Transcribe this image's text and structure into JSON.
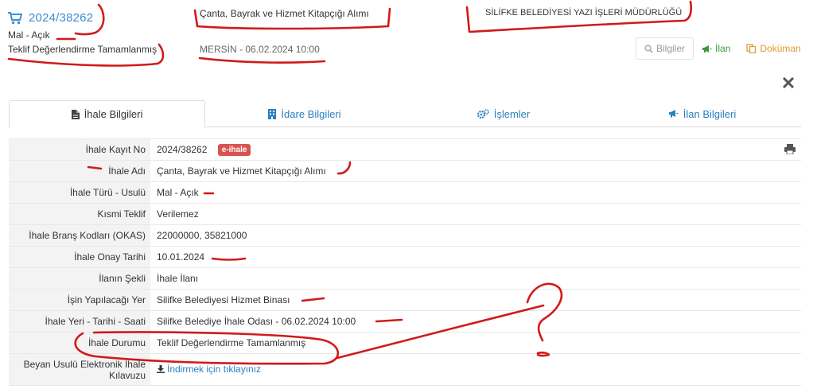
{
  "header": {
    "tender_no": "2024/38262",
    "type_line": "Mal - Açık",
    "status_line": "Teklif Değerlendirme Tamamlanmış",
    "title": "Çanta, Bayrak ve Hizmet Kitapçığı Alımı",
    "location_date": "MERSİN - 06.02.2024 10:00",
    "institution": "SİLİFKE BELEDİYESİ YAZI İŞLERİ MÜDÜRLÜĞÜ",
    "buttons": {
      "bilgiler": "Bilgiler",
      "ilan": "İlan",
      "dokuman": "Doküman"
    }
  },
  "tabs": [
    {
      "label": "İhale Bilgileri",
      "icon": "document-icon",
      "active": true
    },
    {
      "label": "İdare Bilgileri",
      "icon": "building-icon",
      "active": false
    },
    {
      "label": "İşlemler",
      "icon": "gears-icon",
      "active": false
    },
    {
      "label": "İlan Bilgileri",
      "icon": "megaphone-icon",
      "active": false
    }
  ],
  "details": {
    "kayit_no": {
      "label": "İhale Kayıt No",
      "value": "2024/38262",
      "badge": "e-ihale"
    },
    "ihale_adi": {
      "label": "İhale Adı",
      "value": "Çanta, Bayrak ve Hizmet Kitapçığı Alımı"
    },
    "turu_usulu": {
      "label": "İhale Türü - Usulü",
      "value": "Mal - Açık"
    },
    "kismi_teklif": {
      "label": "Kısmi Teklif",
      "value": "Verilemez"
    },
    "okas": {
      "label": "İhale Branş Kodları (OKAS)",
      "value": "22000000, 35821000"
    },
    "onay_tarihi": {
      "label": "İhale Onay Tarihi",
      "value": "10.01.2024"
    },
    "ilan_sekli": {
      "label": "İlanın Şekli",
      "value": "İhale İlanı"
    },
    "yapilacagi_yer": {
      "label": "İşin Yapılacağı Yer",
      "value": "Silifke Belediyesi Hizmet Binası"
    },
    "yeri_tarihi": {
      "label": "İhale Yeri - Tarihi - Saati",
      "value": "Silifke Belediye İhale Odası - 06.02.2024 10:00"
    },
    "durumu": {
      "label": "İhale Durumu",
      "value": "Teklif Değerlendirme Tamamlanmış"
    },
    "kilavuz": {
      "label_line1": "Beyan Usulü Elektronik İhale",
      "label_line2": "Kılavuzu",
      "link": "İndirmek için tıklayınız"
    }
  },
  "colors": {
    "link_blue": "#2a7fc1",
    "badge_red": "#d9534f",
    "ilan_green": "#3c9a3c",
    "dokuman_orange": "#e19a2e",
    "annotation_red": "#d11a1a"
  }
}
